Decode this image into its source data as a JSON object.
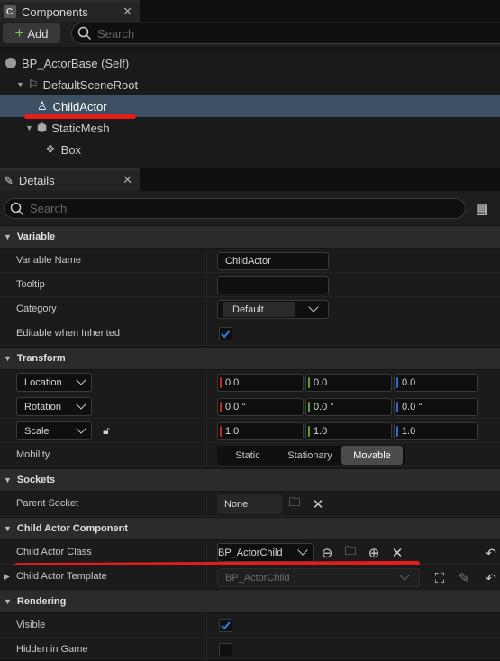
{
  "components_tab": {
    "title": "Components",
    "close": "✕"
  },
  "toolbar": {
    "add_label": "Add",
    "search_placeholder": "Search"
  },
  "tree": {
    "items": [
      {
        "label": "BP_ActorBase (Self)"
      },
      {
        "label": "DefaultSceneRoot"
      },
      {
        "label": "ChildActor"
      },
      {
        "label": "StaticMesh"
      },
      {
        "label": "Box"
      }
    ]
  },
  "details_tab": {
    "title": "Details",
    "close": "✕",
    "search_placeholder": "Search"
  },
  "sections": {
    "variable": "Variable",
    "transform": "Transform",
    "sockets": "Sockets",
    "child_actor_component": "Child Actor Component",
    "rendering": "Rendering"
  },
  "variable": {
    "name_label": "Variable Name",
    "name_value": "ChildActor",
    "tooltip_label": "Tooltip",
    "tooltip_value": "",
    "category_label": "Category",
    "category_value": "Default",
    "editable_label": "Editable when Inherited",
    "editable_checked": true
  },
  "transform": {
    "location": {
      "label": "Location",
      "x": "0.0",
      "y": "0.0",
      "z": "0.0"
    },
    "rotation": {
      "label": "Rotation",
      "x": "0.0 °",
      "y": "0.0 °",
      "z": "0.0 °"
    },
    "scale": {
      "label": "Scale",
      "x": "1.0",
      "y": "1.0",
      "z": "1.0"
    },
    "mobility": {
      "label": "Mobility",
      "options": [
        "Static",
        "Stationary",
        "Movable"
      ],
      "selected": "Movable"
    }
  },
  "sockets": {
    "parent_label": "Parent Socket",
    "parent_value": "None"
  },
  "child_actor": {
    "class_label": "Child Actor Class",
    "class_value": "BP_ActorChild",
    "template_label": "Child Actor Template",
    "template_value": "BP_ActorChild"
  },
  "rendering": {
    "visible_label": "Visible",
    "visible_checked": true,
    "hidden_label": "Hidden in Game",
    "hidden_checked": false
  },
  "colors": {
    "accent_blue": "#3c4f63",
    "check_blue": "#2f80ed",
    "annotation_red": "#e31c1c",
    "axis_x": "#c82828",
    "axis_y": "#5ea02a",
    "axis_z": "#2e6bd3"
  }
}
